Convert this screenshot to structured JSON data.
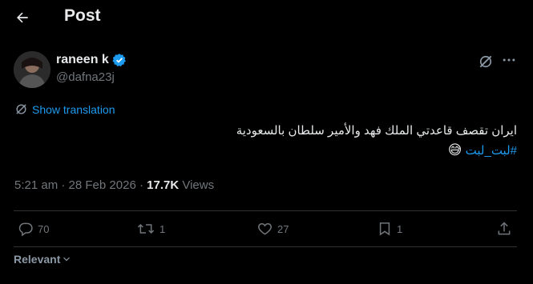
{
  "header": {
    "title": "Post"
  },
  "author": {
    "name": "raneen k",
    "handle": "@dafna23j"
  },
  "translate": {
    "label": "Show translation"
  },
  "tweet": {
    "line1": "ايران تقصف قاعدتي الملك فهد والأمير سلطان بالسعودية",
    "hashtag": "#لبت_لبت",
    "emoji": "😅"
  },
  "meta": {
    "time": "5:21 am",
    "separator": " · ",
    "date": "28 Feb 2026",
    "views_count": "17.7K",
    "views_label": "Views"
  },
  "actions": {
    "replies": "70",
    "reposts": "1",
    "likes": "27",
    "bookmarks": "1"
  },
  "sort": {
    "label": "Relevant"
  },
  "colors": {
    "accent": "#1d9bf0",
    "muted": "#71767b",
    "text": "#e7e9ea",
    "divider": "#2f3336"
  }
}
